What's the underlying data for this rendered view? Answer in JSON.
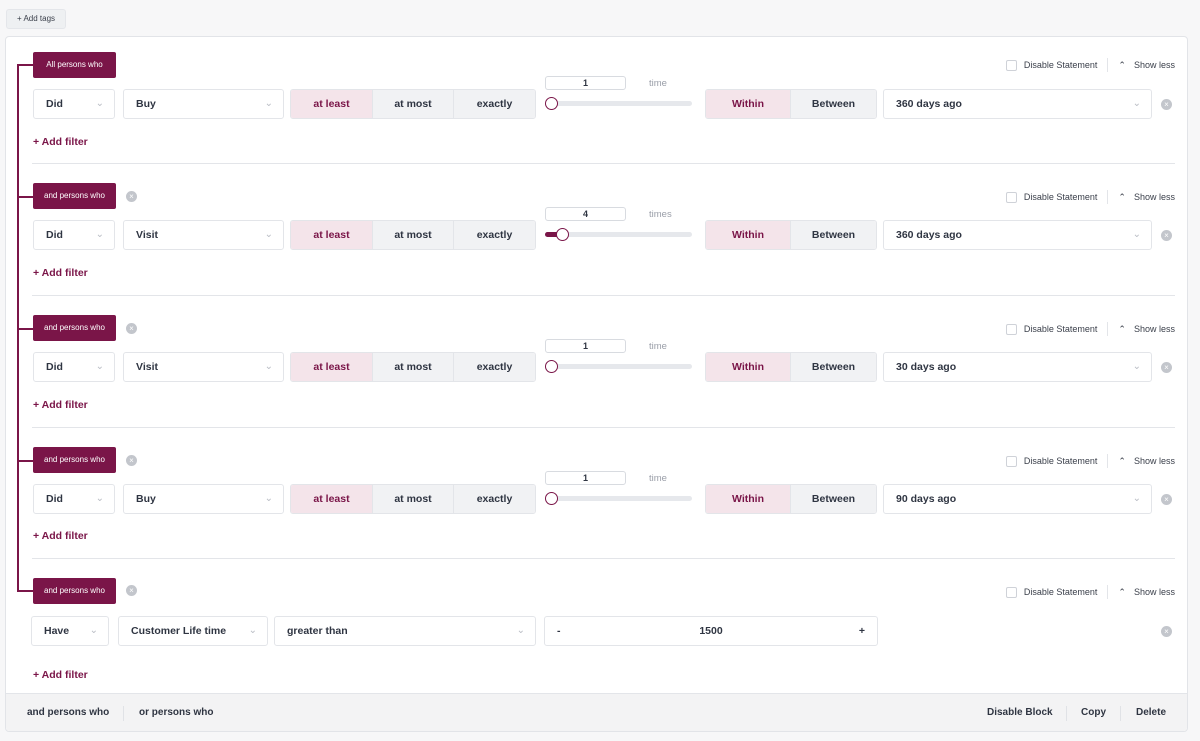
{
  "toolbar": {
    "add_tags_label": "+ Add tags"
  },
  "statement_tools": {
    "disable_statement_label": "Disable Statement",
    "show_less_label": "Show less",
    "add_filter_label": "+ Add filter"
  },
  "statements": [
    {
      "connector": "All persons who",
      "verb": "Did",
      "event": "Buy",
      "comparison_options": [
        "at least",
        "at most",
        "exactly"
      ],
      "comparison_selected": "at least",
      "count": "1",
      "count_unit": "time",
      "slider_fraction": 0.0,
      "time_options": [
        "Within",
        "Between"
      ],
      "time_selected": "Within",
      "time_value": "360 days ago"
    },
    {
      "connector": "and persons who",
      "verb": "Did",
      "event": "Visit",
      "comparison_options": [
        "at least",
        "at most",
        "exactly"
      ],
      "comparison_selected": "at least",
      "count": "4",
      "count_unit": "times",
      "slider_fraction": 0.08,
      "time_options": [
        "Within",
        "Between"
      ],
      "time_selected": "Within",
      "time_value": "360 days ago"
    },
    {
      "connector": "and persons who",
      "verb": "Did",
      "event": "Visit",
      "comparison_options": [
        "at least",
        "at most",
        "exactly"
      ],
      "comparison_selected": "at least",
      "count": "1",
      "count_unit": "time",
      "slider_fraction": 0.0,
      "time_options": [
        "Within",
        "Between"
      ],
      "time_selected": "Within",
      "time_value": "30 days ago"
    },
    {
      "connector": "and persons who",
      "verb": "Did",
      "event": "Buy",
      "comparison_options": [
        "at least",
        "at most",
        "exactly"
      ],
      "comparison_selected": "at least",
      "count": "1",
      "count_unit": "time",
      "slider_fraction": 0.0,
      "time_options": [
        "Within",
        "Between"
      ],
      "time_selected": "Within",
      "time_value": "90 days ago"
    },
    {
      "connector": "and persons who",
      "verb": "Have",
      "attribute": "Customer Life time",
      "operator": "greater than",
      "stepper_minus": "-",
      "stepper_value": "1500",
      "stepper_plus": "+"
    }
  ],
  "footer": {
    "and_label": "and persons who",
    "or_label": "or persons who",
    "disable_block_label": "Disable Block",
    "copy_label": "Copy",
    "delete_label": "Delete"
  },
  "colors": {
    "accent": "#7a1548",
    "accent_light": "#f4e4ea"
  }
}
